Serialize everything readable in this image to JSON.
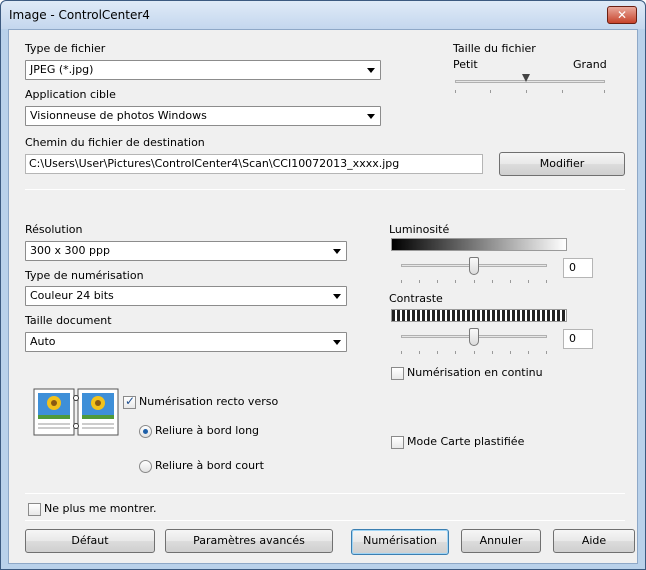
{
  "window": {
    "title": "Image - ControlCenter4",
    "close_glyph": "✕"
  },
  "file_type": {
    "label": "Type de fichier",
    "selected": "JPEG (*.jpg)"
  },
  "file_size": {
    "label": "Taille du fichier",
    "min_label": "Petit",
    "max_label": "Grand",
    "level": 0.5
  },
  "target_app": {
    "label": "Application cible",
    "selected": "Visionneuse de photos Windows"
  },
  "destination": {
    "label": "Chemin du fichier de destination",
    "path": "C:\\Users\\User\\Pictures\\ControlCenter4\\Scan\\CCI10072013_xxxx.jpg",
    "modify_label": "Modifier"
  },
  "resolution": {
    "label": "Résolution",
    "selected": "300 x 300 ppp"
  },
  "scan_type": {
    "label": "Type de numérisation",
    "selected": "Couleur 24 bits"
  },
  "doc_size": {
    "label": "Taille document",
    "selected": "Auto"
  },
  "brightness": {
    "label": "Luminosité",
    "value": "0",
    "level": 0.5
  },
  "contrast": {
    "label": "Contraste",
    "value": "0",
    "level": 0.5
  },
  "continuous_scan": {
    "label": "Numérisation en continu",
    "checked": false
  },
  "duplex": {
    "label": "Numérisation recto verso",
    "checked": true,
    "icon": "duplex-scan-icon",
    "long_edge_label": "Reliure à bord long",
    "long_edge_selected": true,
    "short_edge_label": "Reliure à bord court",
    "short_edge_selected": false
  },
  "laminated_card": {
    "label": "Mode Carte plastifiée",
    "checked": false
  },
  "dont_show": {
    "label": "Ne plus me montrer.",
    "checked": false
  },
  "buttons": {
    "default": "Défaut",
    "advanced": "Paramètres avancés",
    "scan": "Numérisation",
    "cancel": "Annuler",
    "help": "Aide"
  }
}
